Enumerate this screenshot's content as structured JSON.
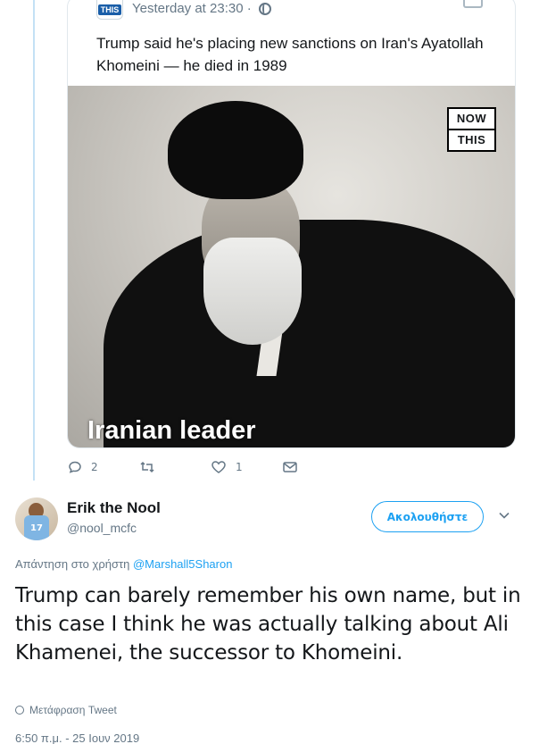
{
  "embedded": {
    "logo_label": "THIS",
    "time": "Yesterday at 23:30 ·",
    "text": "Trump said he's placing new sanctions on Iran's Ayatollah Khomeini — he died in 1989",
    "image": {
      "brand_top": "NOW",
      "brand_bottom": "THIS",
      "caption": "Iranian leader"
    }
  },
  "actions": {
    "reply_count": "2",
    "retweet_count": "",
    "like_count": "1"
  },
  "reply": {
    "name": "Erik the Nool",
    "handle": "@nool_mcfc",
    "avatar_number": "17",
    "follow_label": "Ακολουθήστε",
    "reply_to_prefix": "Απάντηση στο χρήστη",
    "reply_to_mention": "@Marshall5Sharon",
    "text": "Trump can barely remember his own name, but in this case I think he was actually talking about Ali Khamenei, the successor to Khomeini.",
    "translate_label": "Μετάφραση Tweet",
    "timestamp": "6:50 π.μ. - 25 Ιουν 2019"
  },
  "colors": {
    "accent": "#1da1f2",
    "muted": "#657786",
    "thread_line": "#c4e1f5"
  },
  "icons": [
    "reply-icon",
    "retweet-icon",
    "like-icon",
    "message-icon",
    "globe-icon",
    "chevron-down-icon",
    "thumbs-up-icon"
  ]
}
